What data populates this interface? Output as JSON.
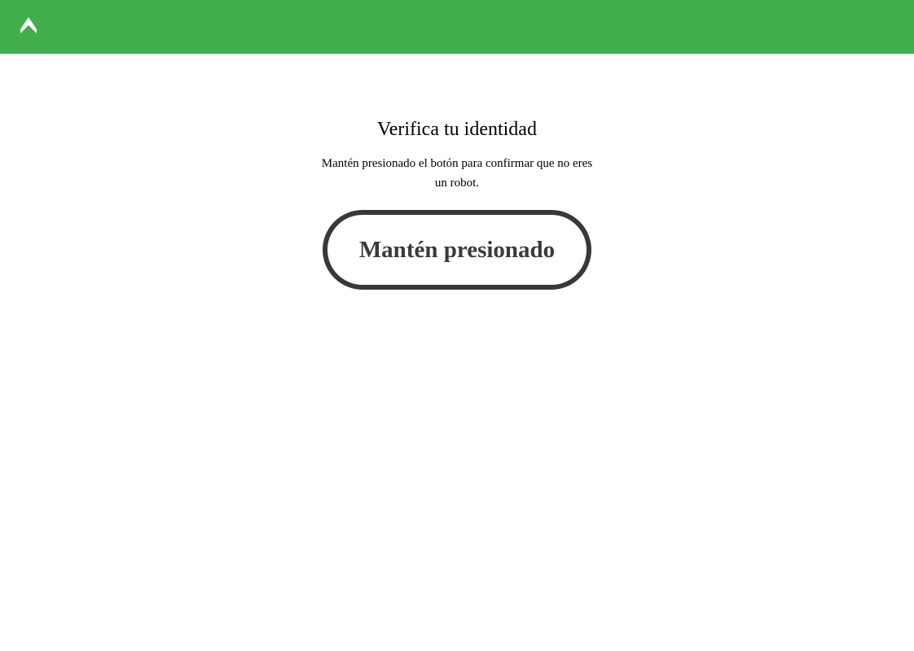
{
  "header": {
    "background_color": "#3fae4b",
    "logo_icon": "chevron-up-logo-icon"
  },
  "main": {
    "title": "Verifica tu identidad",
    "subtitle": "Mantén presionado el botón para confirmar que no eres un robot.",
    "hold_button_label": "Mantén presionado",
    "button_border_color": "#383838"
  }
}
